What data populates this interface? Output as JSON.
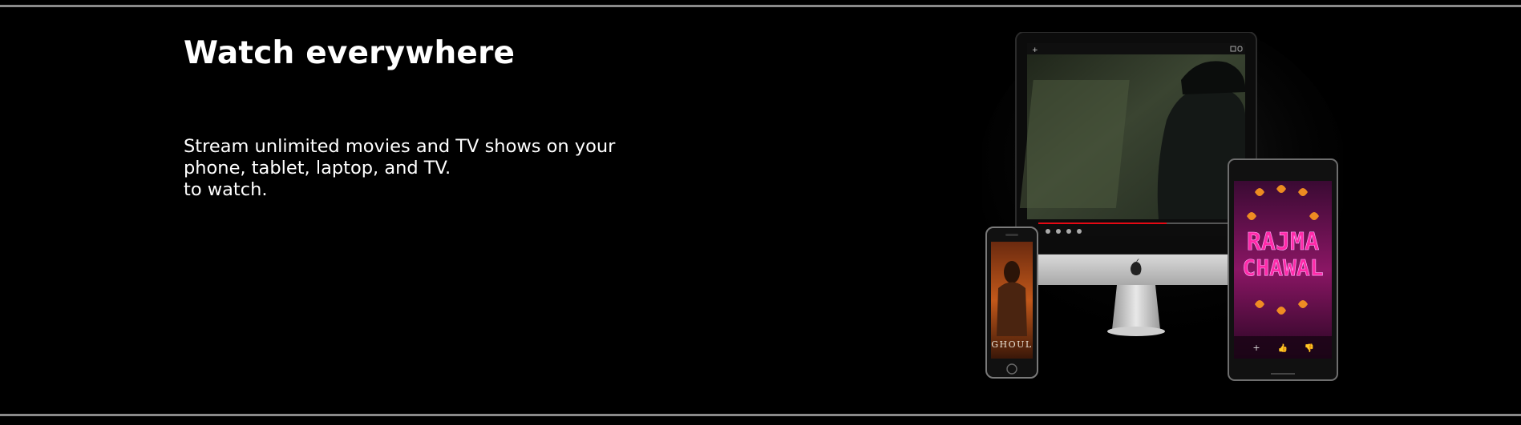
{
  "section": {
    "title": "Watch everywhere",
    "description_lines": [
      "Stream unlimited movies and TV shows on your",
      "phone, tablet, laptop, and TV.",
      "to watch."
    ]
  },
  "devices": {
    "phone_poster_title": "GHOUL",
    "tablet_poster_title_line1": "RAJMA",
    "tablet_poster_title_line2": "CHAWAL",
    "tablet_controls": [
      "+",
      "👍",
      "👎"
    ]
  },
  "colors": {
    "background": "#000000",
    "rule": "#8a8a8a",
    "text": "#ffffff",
    "progress": "#e50914",
    "tablet_title": "#ff2aa8"
  }
}
